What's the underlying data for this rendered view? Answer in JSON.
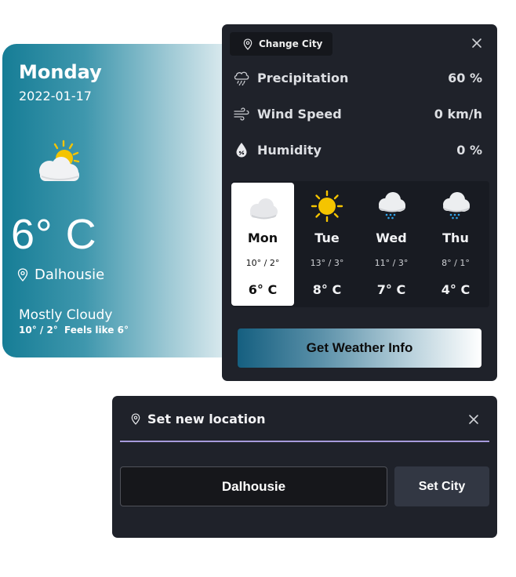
{
  "current": {
    "day": "Monday",
    "date": "2022-01-17",
    "icon": "partly-cloudy-icon",
    "temperature": "6° C",
    "location": "Dalhousie",
    "description": "Mostly Cloudy",
    "range": "10° / 2°",
    "feels_like": "Feels like 6°"
  },
  "details": {
    "change_city_label": "Change City",
    "stats": [
      {
        "label": "Precipitation",
        "value": "60 %",
        "icon": "rain-cloud-icon"
      },
      {
        "label": "Wind Speed",
        "value": "0 km/h",
        "icon": "wind-icon"
      },
      {
        "label": "Humidity",
        "value": "0 %",
        "icon": "humidity-drop-icon"
      }
    ],
    "forecast": [
      {
        "day": "Mon",
        "range": "10° / 2°",
        "temp": "6° C",
        "icon": "cloud-icon",
        "selected": true
      },
      {
        "day": "Tue",
        "range": "13° / 3°",
        "temp": "8° C",
        "icon": "sun-icon",
        "selected": false
      },
      {
        "day": "Wed",
        "range": "11° / 3°",
        "temp": "7° C",
        "icon": "rain-cloud-icon",
        "selected": false
      },
      {
        "day": "Thu",
        "range": "8° / 1°",
        "temp": "4° C",
        "icon": "rain-cloud-icon",
        "selected": false
      }
    ],
    "get_info_label": "Get Weather Info"
  },
  "location_panel": {
    "title": "Set new location",
    "input_value": "Dalhousie",
    "set_city_label": "Set City"
  },
  "colors": {
    "panel_bg": "#1f222a",
    "accent_divider": "#a79bdc",
    "sun": "#f4c400",
    "rain": "#2ea3e8"
  }
}
